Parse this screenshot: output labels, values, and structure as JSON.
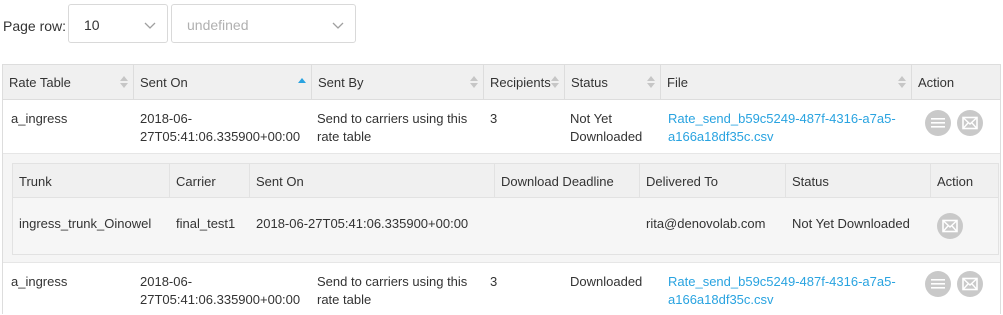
{
  "toolbar": {
    "page_row_label": "Page row:",
    "page_row_value": "10",
    "second_select_value": "undefined"
  },
  "table": {
    "columns": [
      {
        "label": "Rate Table",
        "sort": "both"
      },
      {
        "label": "Sent On",
        "sort": "asc"
      },
      {
        "label": "Sent By",
        "sort": "both"
      },
      {
        "label": "Recipients",
        "sort": "both"
      },
      {
        "label": "Status",
        "sort": "both"
      },
      {
        "label": "File",
        "sort": "both"
      },
      {
        "label": "Action",
        "sort": "none"
      }
    ],
    "rows": [
      {
        "rate_table": "a_ingress",
        "sent_on_1": "2018-06-",
        "sent_on_2": "27T05:41:06.335900+00:00",
        "sent_by_1": "Send to carriers using this",
        "sent_by_2": "rate table",
        "recipients": "3",
        "status_1": "Not Yet",
        "status_2": "Downloaded",
        "file_1": "Rate_send_b59c5249-487f-4316-a7a5-",
        "file_2": "a166a18df35c.csv"
      },
      {
        "rate_table": "a_ingress",
        "sent_on_1": "2018-06-",
        "sent_on_2": "27T05:41:06.335900+00:00",
        "sent_by_1": "Send to carriers using this",
        "sent_by_2": "rate table",
        "recipients": "3",
        "status_1": "Downloaded",
        "status_2": "",
        "file_1": "Rate_send_b59c5249-487f-4316-a7a5-",
        "file_2": "a166a18df35c.csv"
      }
    ]
  },
  "subtable": {
    "columns": [
      "Trunk",
      "Carrier",
      "Sent On",
      "Download Deadline",
      "Delivered To",
      "Status",
      "Action"
    ],
    "rows": [
      {
        "trunk": "ingress_trunk_Oinowel",
        "carrier": "final_test1",
        "sent_on": "2018-06-27T05:41:06.335900+00:00",
        "download_deadline": "",
        "delivered_to": "rita@denovolab.com",
        "status": "Not Yet Downloaded"
      }
    ]
  },
  "icons": {
    "list": "list-icon",
    "mail": "envelope-icon",
    "chevron": "chevron-down-icon"
  },
  "colors": {
    "link": "#29a3e0",
    "header_bg": "#f0f0f0",
    "icon_button": "#c9c9c9"
  }
}
